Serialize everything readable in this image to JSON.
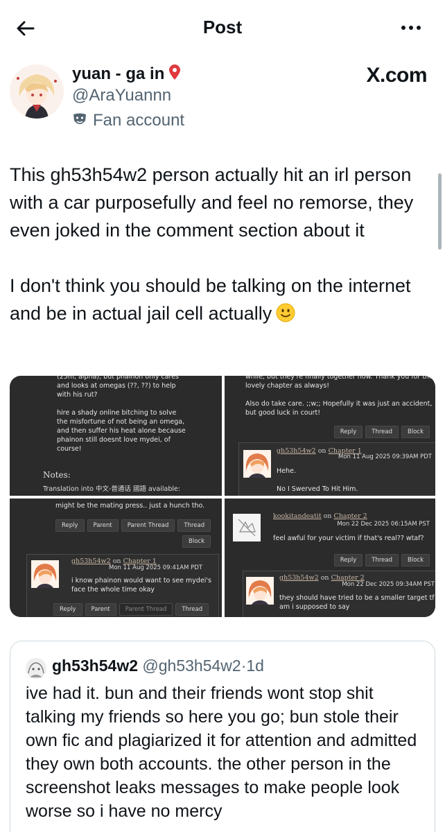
{
  "header": {
    "title": "Post"
  },
  "author": {
    "display_name": "yuan - ga in",
    "handle": "@AraYuannn",
    "badge_label": "Fan account"
  },
  "site_label": "X.com",
  "post": {
    "text": "This gh53h54w2 person actually hit an irl person with a car purposefully and feel no remorse, they even joked in the comment section about it\n\nI don't think you should be talking on the internet and be in actual jail cell actually"
  },
  "media": {
    "shot1": {
      "text": "(25m, alpha), but phainon only cares\nand looks at omegas (??, ??) to help\nwith his rut?\n\nhire a shady online bitching to solve\nthe misfortune of not being an omega,\nand then suffer his heat alone because\nphainon still doesnt love mydei, of\ncourse!",
      "notes_label": "Notes:",
      "translation": "Translation into 中文-普通话 國語 available:"
    },
    "shot2": {
      "text": "while, but they're finally together now. Thank you for the\nlovely chapter as always!\n\nAlso do take care. ;;w;; Hopefully it was just an accident,\nbut good luck in court!",
      "buttons": [
        "Reply",
        "Thread",
        "Block"
      ],
      "reply_user": "gh53h54w2",
      "reply_on": "on",
      "reply_chapter": "Chapter 1",
      "reply_date": "Mon 11 Aug 2025 09:39AM PDT",
      "reply_text": "Hehe.\n\nNo I Swerved To Hit Him."
    },
    "shot3": {
      "top_text": "might be the mating press.. just a hunch tho.",
      "buttons": [
        "Reply",
        "Parent",
        "Parent Thread",
        "Thread"
      ],
      "block_label": "Block",
      "reply_user": "gh53h54w2",
      "reply_on": "on",
      "reply_chapter": "Chapter 1",
      "reply_date": "Mon 11 Aug 2025 09:41AM PDT",
      "reply_text": "i know phainon would want to see mydei's\nface the whole time okay",
      "bottom_buttons": [
        "Reply",
        "Parent",
        "Parent Thread",
        "Thread"
      ]
    },
    "shot4": {
      "c_user": "kookitandeatit",
      "c_on": "on",
      "c_chapter": "Chapter 2",
      "c_date": "Mon 22 Dec 2025 06:15AM PST",
      "c_text": "feel awful for your victim if that's real?? wtaf?",
      "buttons": [
        "Reply",
        "Thread",
        "Block"
      ],
      "reply_user": "gh53h54w2",
      "reply_on": "on",
      "reply_chapter": "Chapter 2",
      "reply_date": "Mon 22 Dec 2025 09:34AM PST",
      "reply_text": "they should have tried to be a smaller target tf\nam i supposed to say"
    }
  },
  "quote": {
    "name": "gh53h54w2",
    "handle": "@gh53h54w2",
    "sep": "·",
    "time": "1d",
    "text": "ive had it. bun and their friends wont stop shit talking my friends so here you go;  bun stole their own fic and plagiarized it for attention and admitted they own both accounts. the other person in the screenshot leaks messages to make people look worse so i have no mercy"
  },
  "colors": {
    "text": "#0f1419",
    "secondary": "#536471",
    "border": "#cfd9de",
    "ao3_bg": "#2b2b2b"
  }
}
